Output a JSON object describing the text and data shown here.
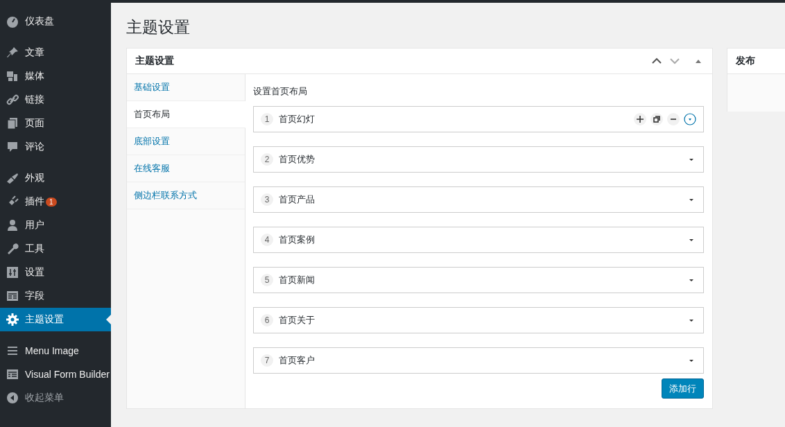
{
  "sidebar": {
    "groups": [
      [
        {
          "label": "仪表盘",
          "selected": false
        }
      ],
      [
        {
          "label": "文章",
          "selected": false
        },
        {
          "label": "媒体",
          "selected": false
        },
        {
          "label": "链接",
          "selected": false
        },
        {
          "label": "页面",
          "selected": false
        },
        {
          "label": "评论",
          "selected": false
        }
      ],
      [
        {
          "label": "外观",
          "selected": false
        },
        {
          "label": "插件",
          "selected": false,
          "badge": "1"
        },
        {
          "label": "用户",
          "selected": false
        },
        {
          "label": "工具",
          "selected": false
        },
        {
          "label": "设置",
          "selected": false
        },
        {
          "label": "字段",
          "selected": false
        },
        {
          "label": "主题设置",
          "selected": true
        }
      ],
      [
        {
          "label": "Menu Image",
          "selected": false
        },
        {
          "label": "Visual Form Builder",
          "selected": false
        },
        {
          "label": "收起菜单",
          "selected": false,
          "kind": "collapse"
        }
      ]
    ]
  },
  "page_title": "主题设置",
  "settings_box": {
    "title": "主题设置",
    "tabs": [
      {
        "label": "基础设置",
        "selected": false
      },
      {
        "label": "首页布局",
        "selected": true
      },
      {
        "label": "底部设置",
        "selected": false
      },
      {
        "label": "在线客服",
        "selected": false
      },
      {
        "label": "侧边栏联系方式",
        "selected": false
      }
    ],
    "section_heading": "设置首页布局",
    "rows": [
      {
        "number": "1",
        "title": "首页幻灯",
        "active": true
      },
      {
        "number": "2",
        "title": "首页优势",
        "active": false
      },
      {
        "number": "3",
        "title": "首页产品",
        "active": false
      },
      {
        "number": "4",
        "title": "首页案例",
        "active": false
      },
      {
        "number": "5",
        "title": "首页新闻",
        "active": false
      },
      {
        "number": "6",
        "title": "首页关于",
        "active": false
      },
      {
        "number": "7",
        "title": "首页客户",
        "active": false
      }
    ],
    "add_button": "添加行"
  },
  "publish_box": {
    "title": "发布"
  }
}
